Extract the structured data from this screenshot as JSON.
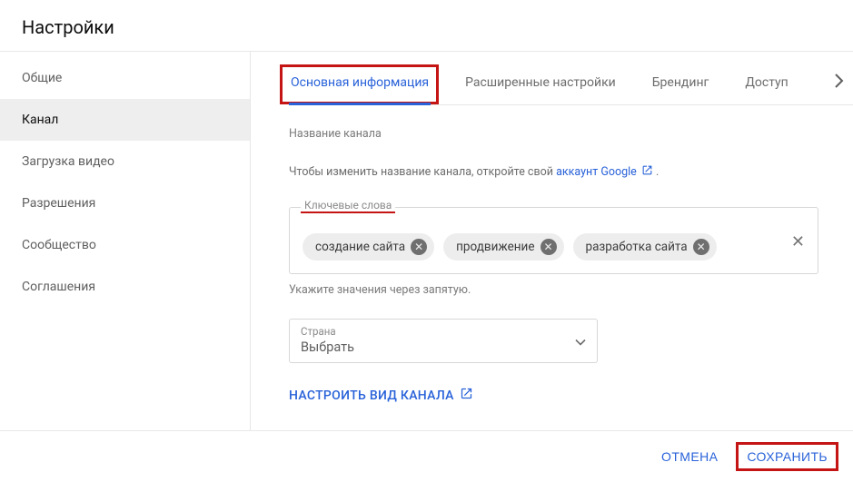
{
  "header": {
    "title": "Настройки"
  },
  "sidebar": {
    "items": [
      {
        "label": "Общие"
      },
      {
        "label": "Канал"
      },
      {
        "label": "Загрузка видео"
      },
      {
        "label": "Разрешения"
      },
      {
        "label": "Сообщество"
      },
      {
        "label": "Соглашения"
      }
    ],
    "active_index": 1
  },
  "tabs": {
    "items": [
      {
        "label": "Основная информация"
      },
      {
        "label": "Расширенные настройки"
      },
      {
        "label": "Брендинг"
      },
      {
        "label": "Доступ"
      }
    ],
    "active_index": 0
  },
  "channel_name": {
    "label": "Название канала",
    "help_prefix": "Чтобы изменить название канала, откройте свой ",
    "link_text": "аккаунт Google"
  },
  "keywords": {
    "legend": "Ключевые слова",
    "chips": [
      "создание сайта",
      "продвижение",
      "разработка сайта"
    ],
    "hint": "Укажите значения через запятую."
  },
  "country_select": {
    "label": "Страна",
    "value": "Выбрать"
  },
  "customize_link": "НАСТРОИТЬ ВИД КАНАЛА",
  "footer": {
    "cancel": "ОТМЕНА",
    "save": "СОХРАНИТЬ"
  }
}
